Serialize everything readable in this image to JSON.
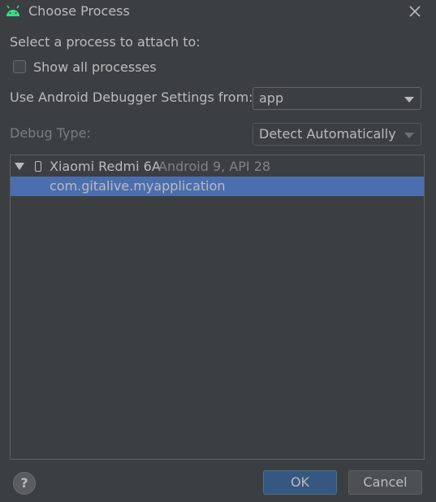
{
  "window": {
    "title": "Choose Process",
    "icon": "android-icon"
  },
  "prompt": "Select a process to attach to:",
  "show_all": {
    "label": "Show all processes",
    "checked": false
  },
  "debugger_settings": {
    "label": "Use Android Debugger Settings from:",
    "value": "app"
  },
  "debug_type": {
    "label": "Debug Type:",
    "value": "Detect Automatically"
  },
  "tree": {
    "device": {
      "name": "Xiaomi Redmi 6A",
      "info": "Android 9, API 28"
    },
    "process": "com.gitalive.myapplication"
  },
  "footer": {
    "help": "?",
    "ok": "OK",
    "cancel": "Cancel"
  },
  "colors": {
    "selection": "#4b6eaf",
    "background": "#3c3f41",
    "android_green": "#3ddc84"
  }
}
